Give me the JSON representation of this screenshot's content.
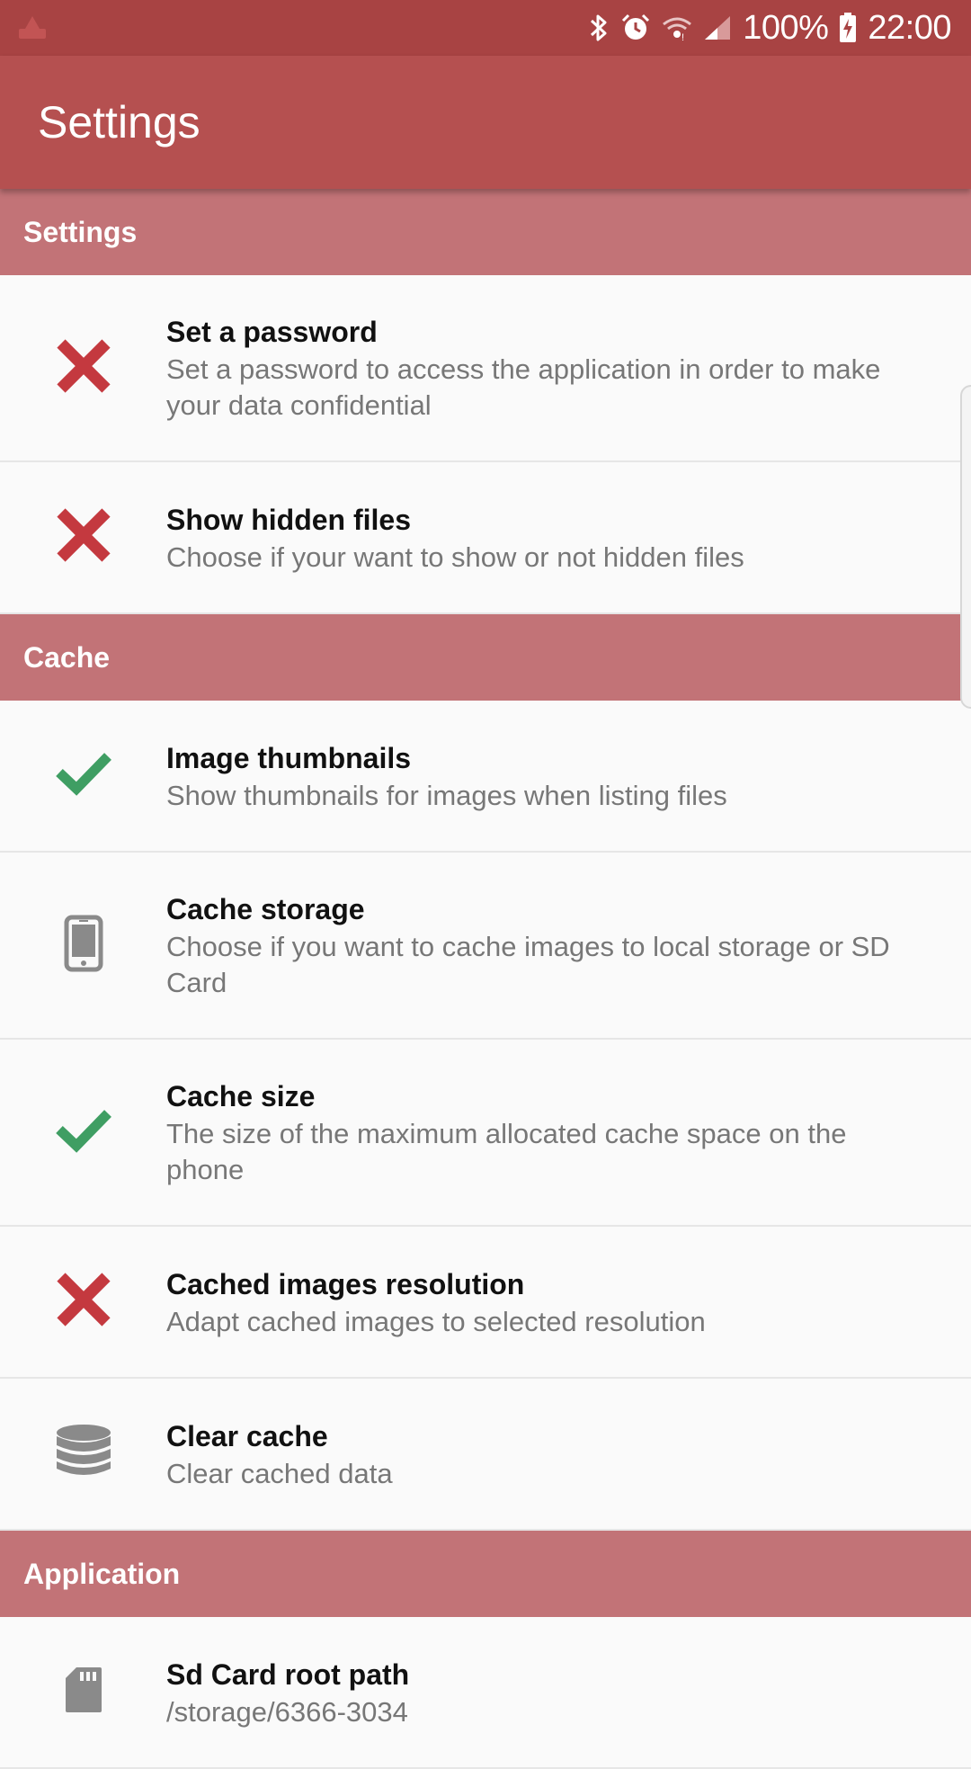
{
  "status_bar": {
    "battery": "100%",
    "time": "22:00",
    "icons": [
      "notification-icon",
      "bluetooth-icon",
      "alarm-icon",
      "wifi-icon",
      "signal-icon",
      "battery-charging-icon"
    ]
  },
  "app_bar": {
    "title": "Settings"
  },
  "sections": {
    "settings": {
      "header": "Settings",
      "items": [
        {
          "title": "Set a password",
          "subtitle": "Set a password to access the application in order to make your data confidential",
          "icon": "cross-icon"
        },
        {
          "title": "Show hidden files",
          "subtitle": "Choose if your want to show or not hidden files",
          "icon": "cross-icon"
        }
      ]
    },
    "cache": {
      "header": "Cache",
      "items": [
        {
          "title": "Image thumbnails",
          "subtitle": "Show thumbnails for images when listing files",
          "icon": "check-icon"
        },
        {
          "title": "Cache storage",
          "subtitle": "Choose if you want to cache images to local storage or SD Card",
          "icon": "phone-icon"
        },
        {
          "title": "Cache size",
          "subtitle": "The size of the maximum allocated cache space on the phone",
          "icon": "check-icon"
        },
        {
          "title": "Cached images resolution",
          "subtitle": "Adapt cached images to selected resolution",
          "icon": "cross-icon"
        },
        {
          "title": "Clear cache",
          "subtitle": "Clear cached data",
          "icon": "database-icon"
        }
      ]
    },
    "application": {
      "header": "Application",
      "items": [
        {
          "title": "Sd Card root path",
          "subtitle": "/storage/6366-3034",
          "icon": "sd-card-icon"
        }
      ]
    }
  },
  "colors": {
    "status_bar": "#a84343",
    "app_bar": "#b55050",
    "section_header": "#c27377",
    "cross": "#c4393f",
    "check": "#3f9e63",
    "neutral_icon": "#8a8a8a"
  }
}
